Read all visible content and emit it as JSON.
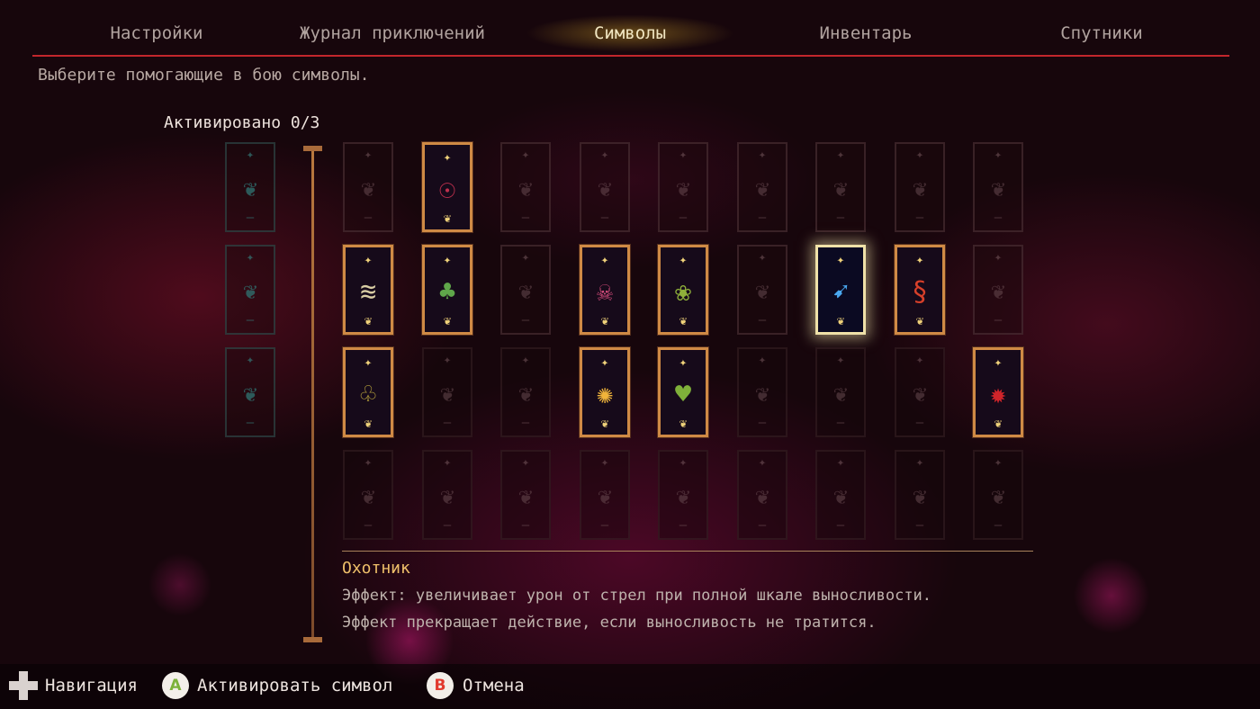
{
  "nav": {
    "tabs": [
      {
        "label": "Настройки",
        "active": false
      },
      {
        "label": "Журнал приключений",
        "active": false
      },
      {
        "label": "Символы",
        "active": true
      },
      {
        "label": "Инвентарь",
        "active": false
      },
      {
        "label": "Спутники",
        "active": false
      }
    ],
    "active_tab_index": 2
  },
  "prompt": "Выберите помогающие в бою символы.",
  "activated_label": "Активировано 0/3",
  "slots": [
    {
      "state": "empty"
    },
    {
      "state": "empty"
    },
    {
      "state": "empty"
    }
  ],
  "grid": {
    "columns": 9,
    "rows": [
      [
        {
          "state": "empty",
          "icon": "empty-slot-icon"
        },
        {
          "state": "unlocked",
          "icon": "eye-totem-icon",
          "color": "#c0304e"
        },
        {
          "state": "empty",
          "icon": "empty-slot-icon"
        },
        {
          "state": "empty",
          "icon": "empty-slot-icon"
        },
        {
          "state": "empty",
          "icon": "empty-slot-icon"
        },
        {
          "state": "empty",
          "icon": "empty-slot-icon"
        },
        {
          "state": "empty",
          "icon": "empty-slot-icon"
        },
        {
          "state": "empty",
          "icon": "empty-slot-icon"
        },
        {
          "state": "empty",
          "icon": "empty-slot-icon"
        }
      ],
      [
        {
          "state": "unlocked",
          "icon": "feather-wind-icon",
          "color": "#d9cda4"
        },
        {
          "state": "unlocked",
          "icon": "gnome-adventurer-icon",
          "color": "#5fa64a"
        },
        {
          "state": "empty",
          "icon": "empty-slot-icon"
        },
        {
          "state": "unlocked",
          "icon": "horned-skull-icon",
          "color": "#d24b7a"
        },
        {
          "state": "unlocked",
          "icon": "green-sprout-icon",
          "color": "#8fb03a"
        },
        {
          "state": "empty",
          "icon": "empty-slot-icon"
        },
        {
          "state": "selected",
          "icon": "arrow-icon",
          "color": "#4aa8f0",
          "name": "Охотник"
        },
        {
          "state": "unlocked",
          "icon": "red-serpent-icon",
          "color": "#d7402a"
        },
        {
          "state": "empty",
          "icon": "empty-slot-icon"
        }
      ],
      [
        {
          "state": "unlocked",
          "icon": "clover-icon",
          "color": "#b7a23c"
        },
        {
          "state": "locked",
          "icon": "empty-slot-icon"
        },
        {
          "state": "locked",
          "icon": "empty-slot-icon"
        },
        {
          "state": "unlocked",
          "icon": "golden-sparks-icon",
          "color": "#f0b43a"
        },
        {
          "state": "unlocked",
          "icon": "heart-sprite-icon",
          "color": "#7fb03a"
        },
        {
          "state": "locked",
          "icon": "empty-slot-icon"
        },
        {
          "state": "locked",
          "icon": "empty-slot-icon"
        },
        {
          "state": "locked",
          "icon": "empty-slot-icon"
        },
        {
          "state": "unlocked",
          "icon": "red-crab-icon",
          "color": "#d0242a"
        }
      ],
      [
        {
          "state": "locked",
          "icon": "empty-slot-icon"
        },
        {
          "state": "locked",
          "icon": "empty-slot-icon"
        },
        {
          "state": "locked",
          "icon": "empty-slot-icon"
        },
        {
          "state": "locked",
          "icon": "empty-slot-icon"
        },
        {
          "state": "locked",
          "icon": "empty-slot-icon"
        },
        {
          "state": "locked",
          "icon": "empty-slot-icon"
        },
        {
          "state": "locked",
          "icon": "empty-slot-icon"
        },
        {
          "state": "locked",
          "icon": "empty-slot-icon"
        },
        {
          "state": "locked",
          "icon": "empty-slot-icon"
        }
      ]
    ]
  },
  "description": {
    "title": "Охотник",
    "line1": "Эффект: увеличивает урон от стрел при полной шкале выносливости.",
    "line2": "Эффект прекращает действие, если выносливость не тратится."
  },
  "footer": {
    "nav_label": "Навигация",
    "a_button": "A",
    "a_label": "Активировать символ",
    "b_button": "B",
    "b_label": "Отмена"
  },
  "colors": {
    "accent_red": "#c2262c",
    "active_tab_glow": "#cda028",
    "card_frame": "#cf8a45",
    "description_title": "#efc06a",
    "a_button": "#7db23a",
    "b_button": "#e23a2e"
  }
}
